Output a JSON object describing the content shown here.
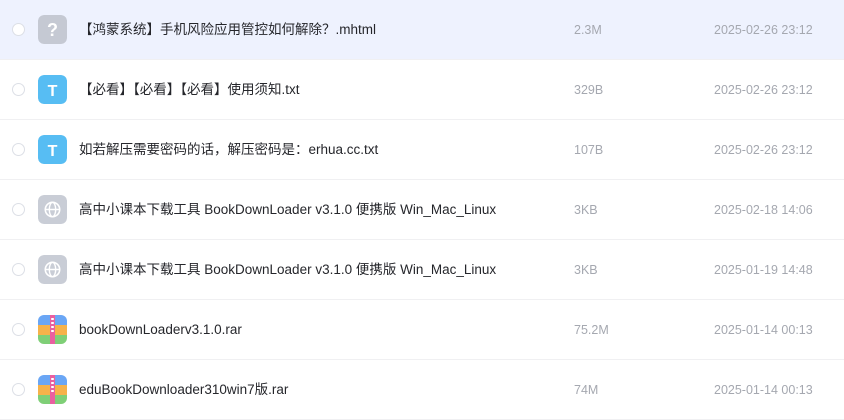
{
  "files": [
    {
      "name": "【鸿蒙系统】手机风险应用管控如何解除？.mhtml",
      "size": "2.3M",
      "date": "2025-02-26 23:12",
      "icon": "unknown-file-icon",
      "selected": true
    },
    {
      "name": "【必看】【必看】【必看】使用须知.txt",
      "size": "329B",
      "date": "2025-02-26 23:12",
      "icon": "text-file-icon",
      "selected": false
    },
    {
      "name": "如若解压需要密码的话，解压密码是：erhua.cc.txt",
      "size": "107B",
      "date": "2025-02-26 23:12",
      "icon": "text-file-icon",
      "selected": false
    },
    {
      "name": "高中小课本下载工具 BookDownLoader v3.1.0 便携版 Win_Mac_Linux",
      "size": "3KB",
      "date": "2025-02-18 14:06",
      "icon": "web-link-icon",
      "selected": false
    },
    {
      "name": "高中小课本下载工具 BookDownLoader v3.1.0 便携版 Win_Mac_Linux",
      "size": "3KB",
      "date": "2025-01-19 14:48",
      "icon": "web-link-icon",
      "selected": false
    },
    {
      "name": "bookDownLoaderv3.1.0.rar",
      "size": "75.2M",
      "date": "2025-01-14 00:13",
      "icon": "archive-icon",
      "selected": false
    },
    {
      "name": "eduBookDownloader310win7版.rar",
      "size": "74M",
      "date": "2025-01-14 00:13",
      "icon": "archive-icon",
      "selected": false
    }
  ],
  "icon_glyphs": {
    "unknown": "?",
    "text": "T"
  },
  "colors": {
    "selected_row": "#eef2fe",
    "text_icon": "#57bdf3",
    "unknown_icon": "#c5c9d3",
    "web_icon": "#c9cdd6",
    "meta_text": "#a5a8b0"
  }
}
